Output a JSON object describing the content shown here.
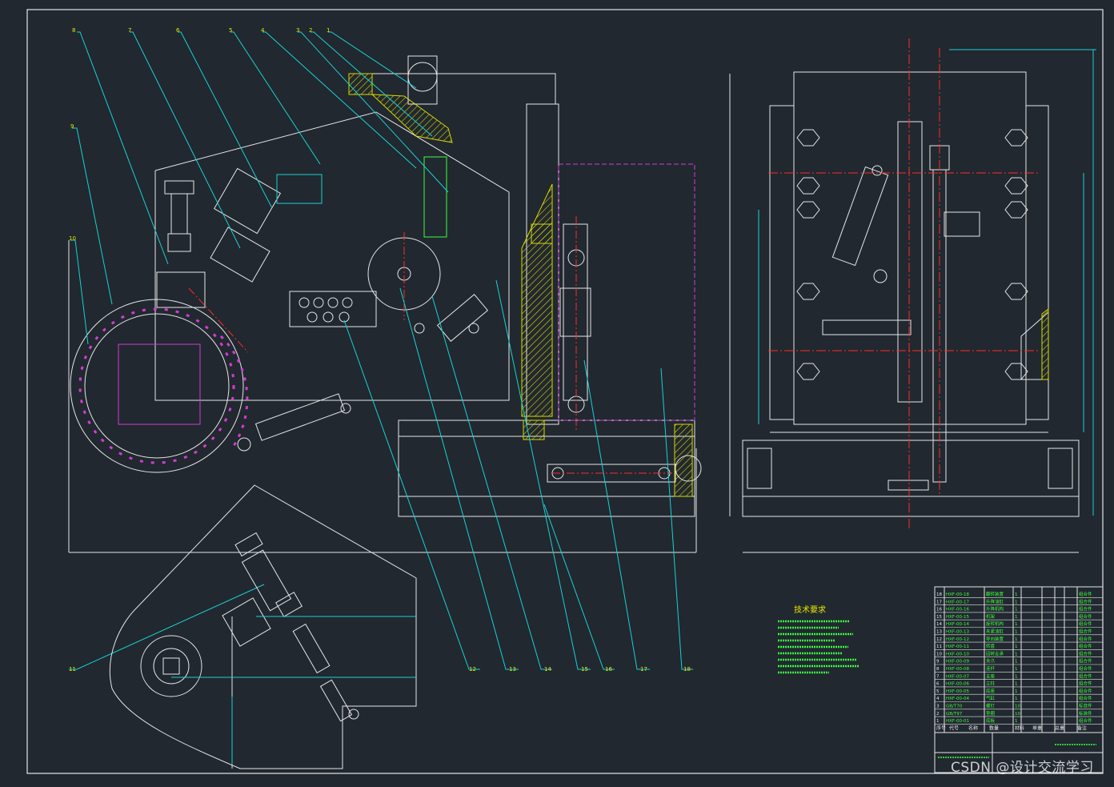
{
  "drawing": {
    "balloon_labels": [
      "1",
      "2",
      "3",
      "4",
      "5",
      "6",
      "7",
      "8",
      "9",
      "10",
      "11",
      "12",
      "13",
      "14",
      "15",
      "16",
      "17",
      "18"
    ],
    "tech_requirements": {
      "title": "技术要求"
    },
    "bom": {
      "header": [
        "序号",
        "代号",
        "名称",
        "数量",
        "材料",
        "单重",
        "总重",
        "备注"
      ],
      "rows": [
        {
          "no": "18",
          "code": "HXF-00-18",
          "name": "翻转装置",
          "qty": "1",
          "note": "组合件"
        },
        {
          "no": "17",
          "code": "HXF-00-17",
          "name": "升降油缸",
          "qty": "1",
          "note": "组合件"
        },
        {
          "no": "16",
          "code": "HXF-00-16",
          "name": "升降机构",
          "qty": "1",
          "note": "组合件"
        },
        {
          "no": "15",
          "code": "HXF-00-15",
          "name": "机架",
          "qty": "1",
          "note": "组合件"
        },
        {
          "no": "14",
          "code": "HXF-00-14",
          "name": "旋转机构",
          "qty": "1",
          "note": "组合件"
        },
        {
          "no": "13",
          "code": "HXF-00-13",
          "name": "夹紧油缸",
          "qty": "1",
          "note": "组合件"
        },
        {
          "no": "12",
          "code": "HXF-00-12",
          "name": "导向装置",
          "qty": "1",
          "note": "组合件"
        },
        {
          "no": "11",
          "code": "HXF-00-11",
          "name": "转盘",
          "qty": "1",
          "note": "组合件"
        },
        {
          "no": "10",
          "code": "HXF-00-10",
          "name": "回转支承",
          "qty": "1",
          "note": "组合件"
        },
        {
          "no": "9",
          "code": "HXF-00-09",
          "name": "夹爪",
          "qty": "1",
          "note": "组合件"
        },
        {
          "no": "8",
          "code": "HXF-00-08",
          "name": "连杆",
          "qty": "1",
          "note": "组合件"
        },
        {
          "no": "7",
          "code": "HXF-00-07",
          "name": "支座",
          "qty": "1",
          "note": "组合件"
        },
        {
          "no": "6",
          "code": "HXF-00-06",
          "name": "立柱",
          "qty": "1",
          "note": "组合件"
        },
        {
          "no": "5",
          "code": "HXF-00-05",
          "name": "底座",
          "qty": "1",
          "note": "组合件"
        },
        {
          "no": "4",
          "code": "HXF-00-04",
          "name": "气缸",
          "qty": "1",
          "note": "组合件"
        },
        {
          "no": "3",
          "code": "GB/T70",
          "name": "螺钉",
          "qty": "10",
          "note": "标准件"
        },
        {
          "no": "2",
          "code": "GB/T97",
          "name": "垫圈",
          "qty": "10",
          "note": "标准件"
        },
        {
          "no": "1",
          "code": "HXF-00-01",
          "name": "底板",
          "qty": "1",
          "note": "组合件"
        }
      ]
    },
    "watermark": "CSDN @设计交流学习",
    "colors": {
      "background": "#212830",
      "outline": "#e6e6e6",
      "leader": "#19d2d2",
      "label": "#e8e800",
      "bom_text": "#3cff3c",
      "centerline": "#ff2a2a",
      "magenta": "#d23cd2",
      "hatch": "#d8d800"
    }
  }
}
